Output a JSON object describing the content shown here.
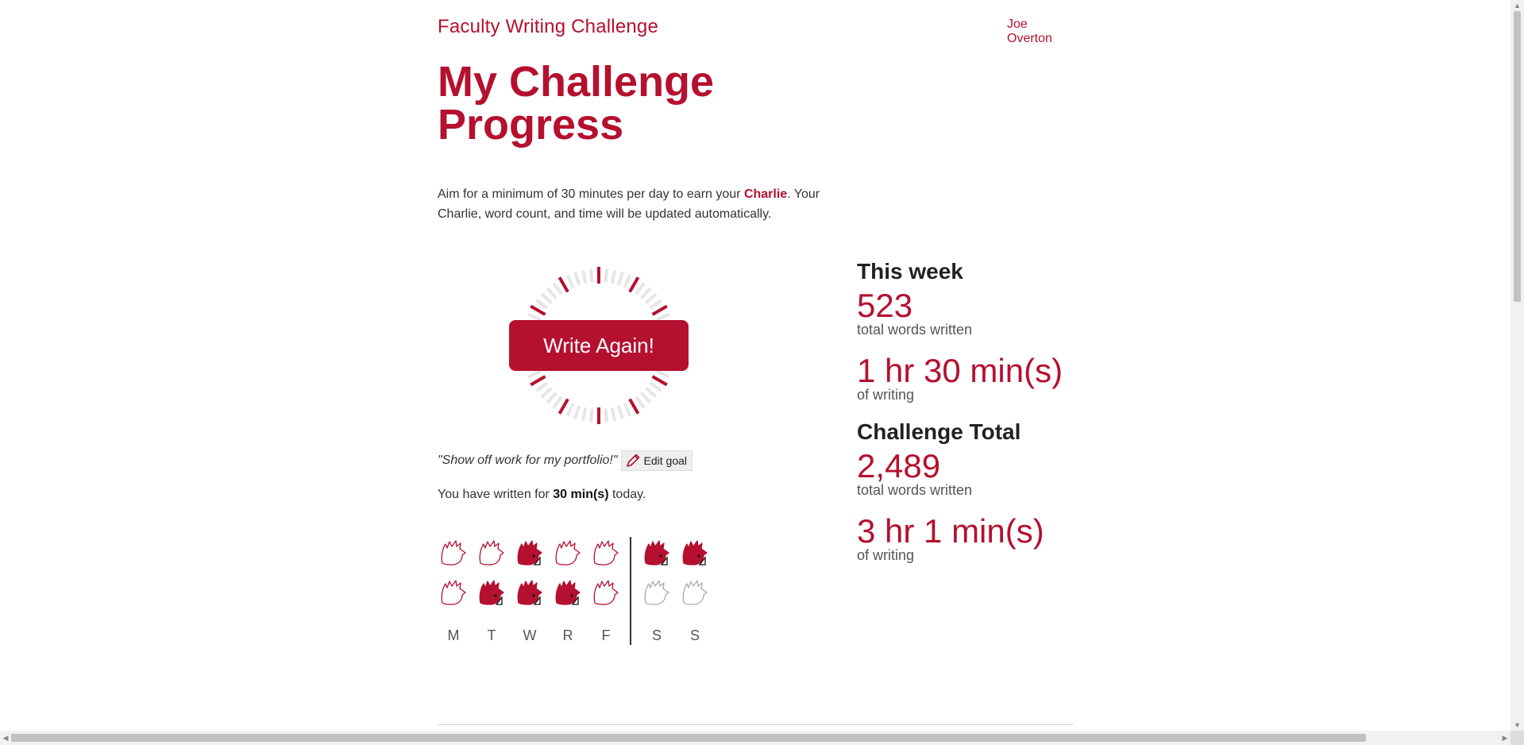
{
  "header": {
    "site_title": "Faculty Writing Challenge",
    "user_name": "Joe Overton"
  },
  "main": {
    "page_title": "My Challenge Progress",
    "intro_before": "Aim for a minimum of 30 minutes per day to earn your ",
    "intro_highlight": "Charlie",
    "intro_after": ". Your Charlie, word count, and time will be updated automatically.",
    "write_button": "Write Again!",
    "goal_quote": "\"Show off work for my portfolio!\"",
    "edit_goal_label": "Edit goal",
    "today_before": "You have written for ",
    "today_time": "30 min(s)",
    "today_after": " today."
  },
  "week": {
    "days": [
      "M",
      "T",
      "W",
      "R",
      "F",
      "S",
      "S"
    ],
    "row1": [
      "outline",
      "outline",
      "filled",
      "outline",
      "outline",
      "filled",
      "filled"
    ],
    "row2": [
      "outline",
      "filled",
      "filled",
      "filled",
      "outline",
      "empty",
      "empty"
    ]
  },
  "stats": {
    "week_heading": "This week",
    "week_words": "523",
    "week_words_label": "total words written",
    "week_time": "1 hr 30 min(s)",
    "week_time_label": "of writing",
    "total_heading": "Challenge Total",
    "total_words": "2,489",
    "total_words_label": "total words written",
    "total_time": "3 hr 1 min(s)",
    "total_time_label": "of writing"
  },
  "colors": {
    "accent": "#b5102f",
    "tick_inactive": "#e6e6e6"
  }
}
